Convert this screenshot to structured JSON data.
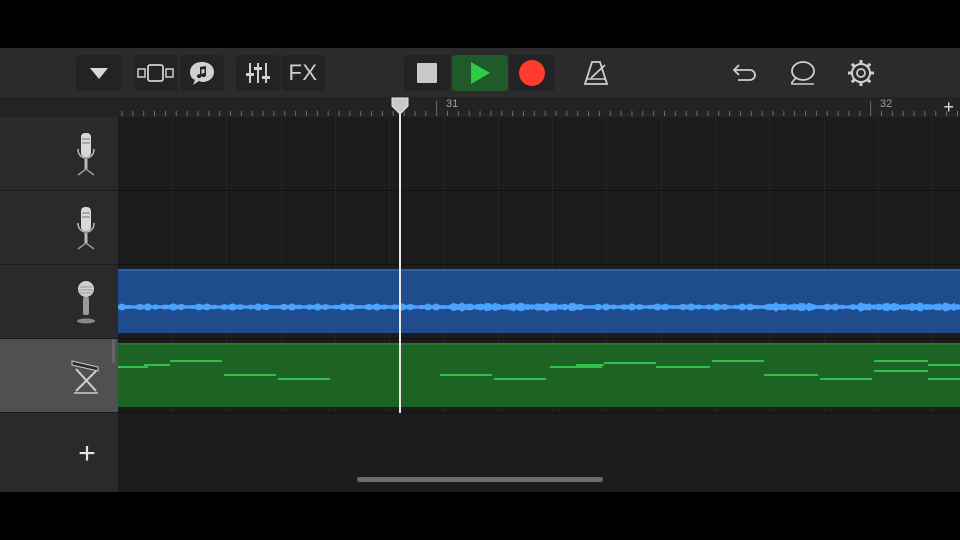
{
  "toolbar": {
    "tracks_menu_icon": "triangle-down-icon",
    "view_toggle_icon": "tracks-view-icon",
    "loop_browser_icon": "loop-browser-icon",
    "mixer_icon": "mixer-sliders-icon",
    "fx_label": "FX",
    "stop_icon": "stop-icon",
    "play_icon": "play-icon",
    "record_icon": "record-icon",
    "metronome_icon": "metronome-icon",
    "undo_icon": "undo-icon",
    "lasso_icon": "lasso-icon",
    "settings_icon": "gear-icon",
    "colors": {
      "play": "#2ecc40",
      "record": "#ff3b30",
      "play_bg": "#1f5a2a"
    }
  },
  "ruler": {
    "bars": [
      "31",
      "32"
    ],
    "add_section_label": "+"
  },
  "tracks": [
    {
      "name": "track-1",
      "icon": "studio-mic-icon"
    },
    {
      "name": "track-2",
      "icon": "studio-mic-icon"
    },
    {
      "name": "track-3",
      "icon": "handheld-mic-icon"
    },
    {
      "name": "track-4",
      "icon": "keyboard-stand-icon",
      "selected": true
    }
  ],
  "add_track_label": "+",
  "regions": {
    "audio": {
      "color": "#1f4c8c",
      "waveform_color": "#4aa3ff"
    },
    "midi": {
      "color": "#1d6424",
      "note_color": "#39e05a"
    }
  }
}
